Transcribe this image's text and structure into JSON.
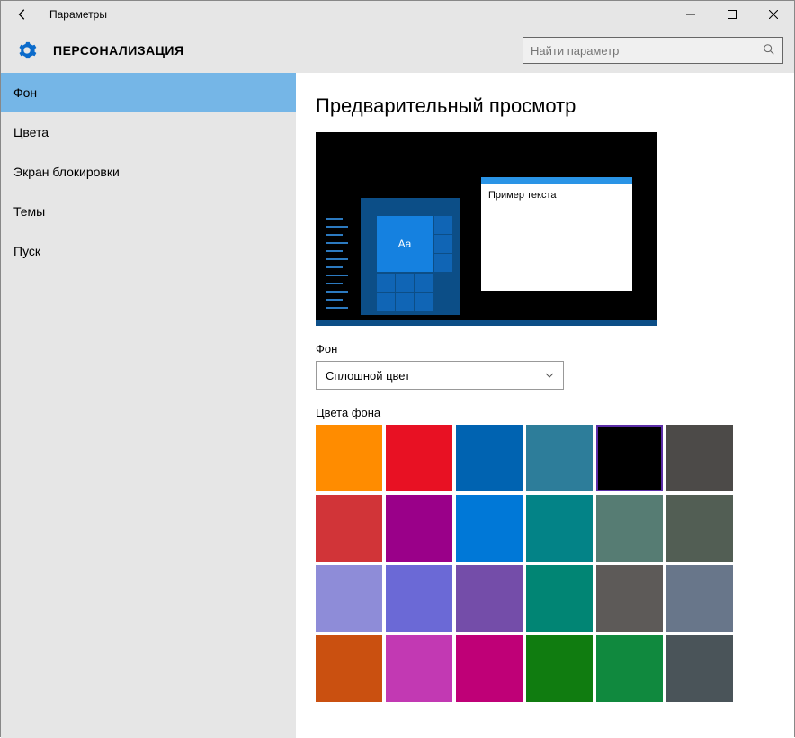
{
  "titlebar": {
    "title": "Параметры"
  },
  "header": {
    "title": "ПЕРСОНАЛИЗАЦИЯ",
    "search_placeholder": "Найти параметр"
  },
  "sidebar": {
    "items": [
      {
        "label": "Фон",
        "active": true
      },
      {
        "label": "Цвета",
        "active": false
      },
      {
        "label": "Экран блокировки",
        "active": false
      },
      {
        "label": "Темы",
        "active": false
      },
      {
        "label": "Пуск",
        "active": false
      }
    ]
  },
  "content": {
    "preview_heading": "Предварительный просмотр",
    "preview_tile_text": "Aa",
    "preview_sample_text": "Пример текста",
    "background_label": "Фон",
    "background_dropdown_value": "Сплошной цвет",
    "swatches_label": "Цвета фона",
    "swatches": [
      "#ff8c00",
      "#e81123",
      "#0063b1",
      "#2d7d9a",
      "#000000",
      "#4c4a48",
      "#d13438",
      "#9a0089",
      "#0078d7",
      "#038387",
      "#567c73",
      "#525e54",
      "#8e8cd8",
      "#6b69d6",
      "#744da9",
      "#018574",
      "#5d5a58",
      "#68768a",
      "#ca5010",
      "#c239b3",
      "#bf0077",
      "#107c10",
      "#10893e",
      "#4a5459"
    ],
    "selected_swatch_index": 4
  }
}
